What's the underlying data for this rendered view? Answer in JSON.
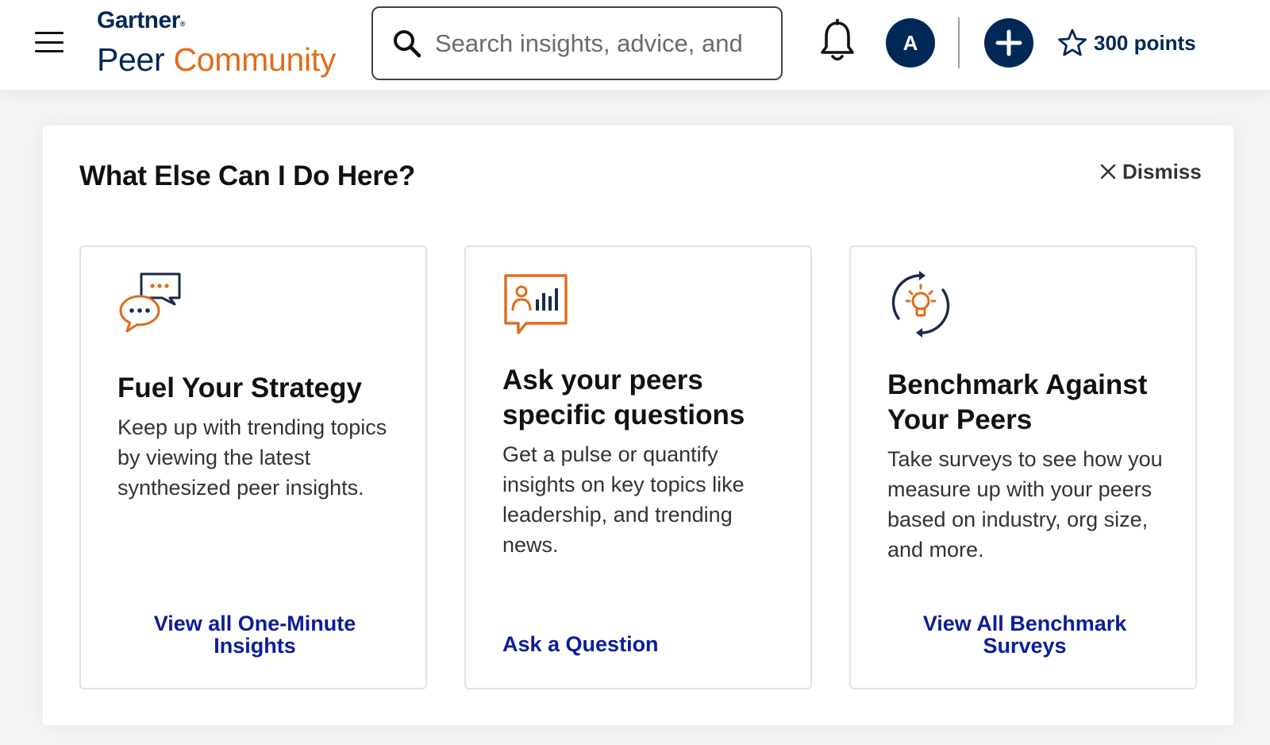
{
  "header": {
    "logo_brand": "Gartner",
    "logo_reg": "®",
    "logo_product_peer": "Peer",
    "logo_product_community": "Community",
    "search_placeholder": "Search insights, advice, and",
    "avatar_initial": "A",
    "points_label": "300 points"
  },
  "panel": {
    "title": "What Else Can I Do Here?",
    "dismiss_label": "Dismiss",
    "cards": [
      {
        "icon": "chat-bubbles-icon",
        "title": "Fuel Your Strategy",
        "body": "Keep up with trending topics by viewing the latest synthesized peer insights.",
        "link_line1": "View all One-Minute",
        "link_line2": "Insights"
      },
      {
        "icon": "poll-chart-icon",
        "title": "Ask your peers specific questions",
        "body": "Get a pulse or quantify insights on key topics like leadership, and trending news.",
        "link_line1": "Ask a Question"
      },
      {
        "icon": "lightbulb-refresh-icon",
        "title": "Benchmark Against Your Peers",
        "body": "Take surveys to see how you measure up with your peers based on industry, org size, and more.",
        "link_line1": "View All Benchmark",
        "link_line2": "Surveys"
      }
    ]
  },
  "colors": {
    "brand_navy": "#002856",
    "accent_orange": "#e06c1c",
    "link_blue": "#0b1d9c"
  }
}
